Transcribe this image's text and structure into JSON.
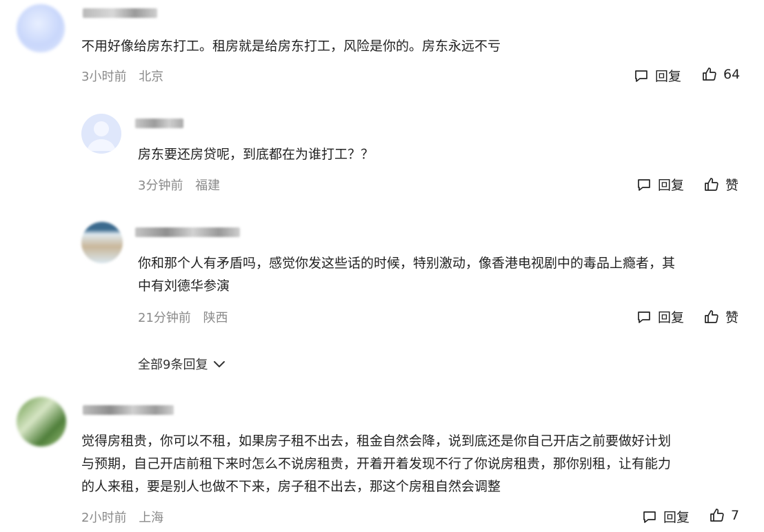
{
  "comments": [
    {
      "text": "不用好像给房东打工。租房就是给房东打工，风险是你的。房东永远不亏",
      "time": "3小时前",
      "location": "北京",
      "reply_label": "回复",
      "like_label": "64"
    },
    {
      "text": "房东要还房贷呢，到底都在为谁打工？？",
      "time": "3分钟前",
      "location": "福建",
      "reply_label": "回复",
      "like_label": "赞"
    },
    {
      "text_lines": [
        "你和那个人有矛盾吗，感觉你发这些话的时候，特别激动，像香港电视剧中的毒品上瘾者，其",
        "中有刘德华参演"
      ],
      "time": "21分钟前",
      "location": "陕西",
      "reply_label": "回复",
      "like_label": "赞"
    },
    {
      "text_lines": [
        "觉得房租贵，你可以不租，如果房子租不出去，租金自然会降，说到底还是你自己开店之前要做好计划",
        "与预期，自己开店前租下来时怎么不说房租贵，开着开着发现不行了你说房租贵，那你别租，让有能力",
        "的人来租，要是别人也做不下来，房子租不出去，那这个房租自然会调整"
      ],
      "time": "2小时前",
      "location": "上海",
      "reply_label": "回复",
      "like_label": "7"
    }
  ],
  "expand_replies": {
    "label": "全部9条回复"
  }
}
